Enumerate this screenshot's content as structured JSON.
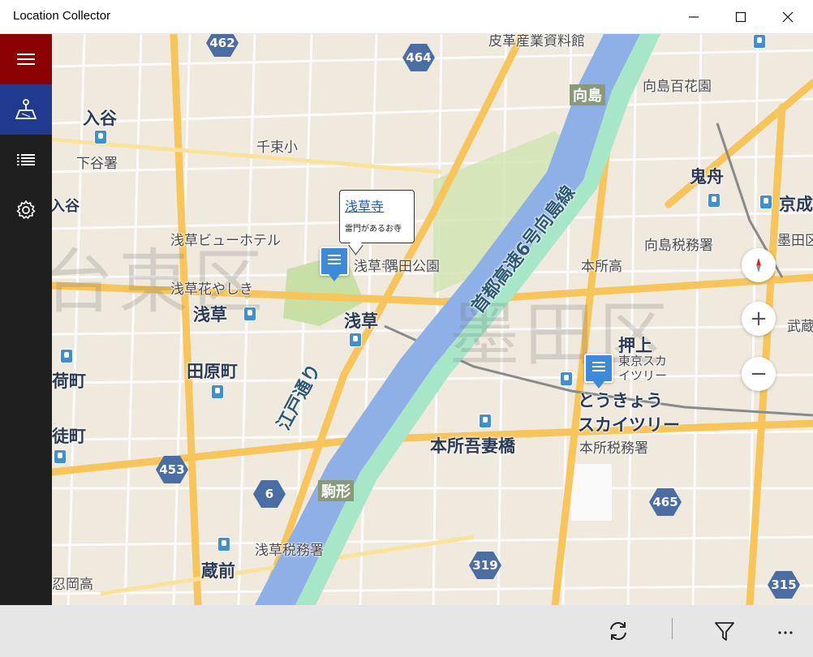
{
  "app": {
    "title": "Location Collector"
  },
  "map": {
    "ward_labels": [
      "台東区",
      "墨田区"
    ],
    "labels": [
      {
        "text": "入谷",
        "style": "big"
      },
      {
        "text": "下谷署",
        "style": "normal"
      },
      {
        "text": "千束小",
        "style": "normal"
      },
      {
        "text": "浅草ビューホテル",
        "style": "normal"
      },
      {
        "text": "浅草花やしき",
        "style": "normal"
      },
      {
        "text": "浅草",
        "style": "big"
      },
      {
        "text": "浅草",
        "style": "big"
      },
      {
        "text": "浅草寺",
        "style": "normal"
      },
      {
        "text": "隅田公園",
        "style": "normal"
      },
      {
        "text": "田原町",
        "style": "big"
      },
      {
        "text": "荷町",
        "style": "big"
      },
      {
        "text": "徒町",
        "style": "big"
      },
      {
        "text": "入谷",
        "style": "big"
      },
      {
        "text": "向島",
        "style": "big"
      },
      {
        "text": "向島百花園",
        "style": "normal"
      },
      {
        "text": "皮革産業資料館",
        "style": "normal"
      },
      {
        "text": "鬼舟",
        "style": "big"
      },
      {
        "text": "京成",
        "style": "big"
      },
      {
        "text": "向島税務署",
        "style": "normal"
      },
      {
        "text": "墨田区",
        "style": "normal"
      },
      {
        "text": "本所高",
        "style": "normal"
      },
      {
        "text": "押上",
        "style": "big"
      },
      {
        "text": "とうきょう",
        "style": "big"
      },
      {
        "text": "スカイツリー",
        "style": "big"
      },
      {
        "text": "本所吾妻橋",
        "style": "big"
      },
      {
        "text": "本所税務署",
        "style": "normal"
      },
      {
        "text": "駒形",
        "style": "big"
      },
      {
        "text": "浅草税務署",
        "style": "normal"
      },
      {
        "text": "蔵前",
        "style": "big"
      },
      {
        "text": "忍岡高",
        "style": "normal"
      },
      {
        "text": "江戸通り",
        "style": "river"
      },
      {
        "text": "首都高速6号向島線",
        "style": "river"
      },
      {
        "text": "武蔵亀",
        "style": "normal"
      }
    ],
    "route_shields": [
      "462",
      "464",
      "453",
      "6",
      "465",
      "319",
      "315"
    ],
    "pins": [
      {
        "name": "浅草寺"
      },
      {
        "name": "東京スカイツリー"
      }
    ],
    "popup": {
      "title": "浅草寺",
      "description": "雷門があるお寺"
    },
    "pin2_label": "東京スカ\nイツリー"
  },
  "controls": {
    "zoom_in": "+",
    "zoom_out": "−"
  },
  "colors": {
    "hamburger_bg": "#8b0000",
    "active_nav_bg": "#1f3a8f",
    "sidebar_bg": "#1f1f1f",
    "river": "#8fb0e6",
    "expressway": "#a8e6c8",
    "road_major": "#f7c55a"
  }
}
